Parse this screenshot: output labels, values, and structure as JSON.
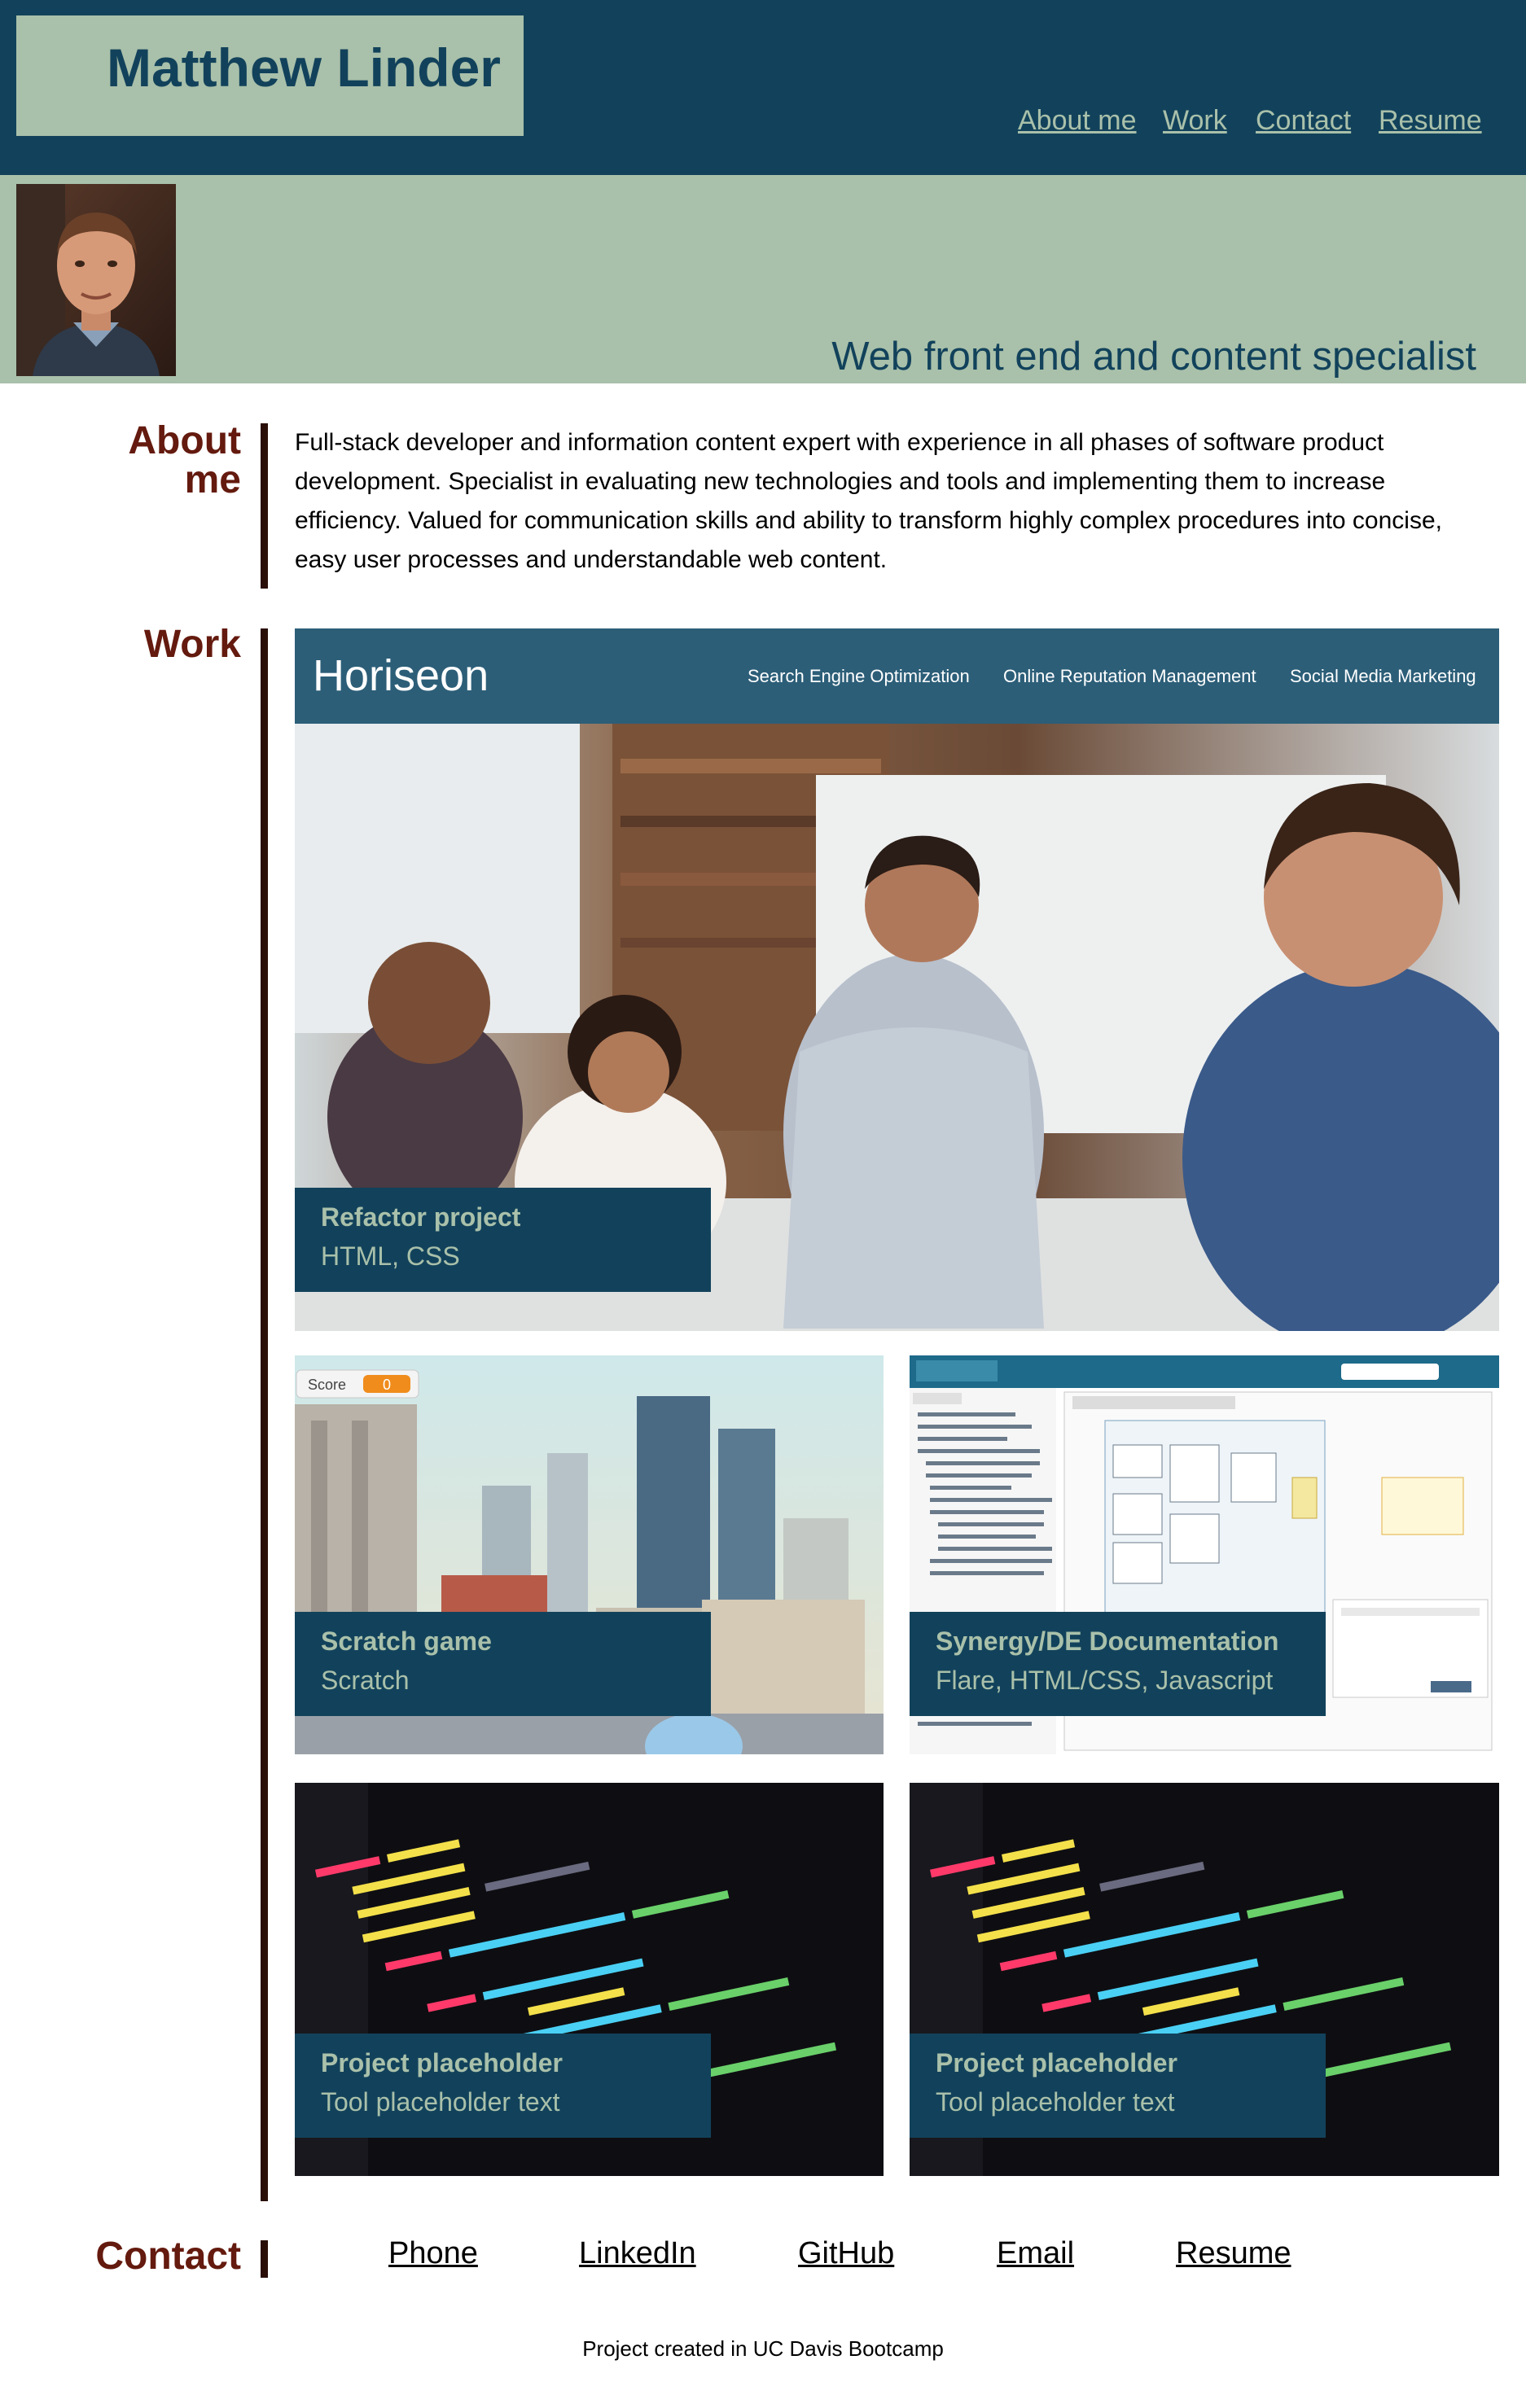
{
  "header": {
    "name": "Matthew Linder",
    "nav": [
      "About me",
      "Work",
      "Contact",
      "Resume"
    ]
  },
  "hero": {
    "tagline": "Web front end and content specialist"
  },
  "about": {
    "heading_line1": "About",
    "heading_line2": "me",
    "text": "Full-stack developer and information content expert with experience in all phases of software product development. Specialist in evaluating new technologies and tools and implementing them to increase efficiency. Valued for communication skills and ability to transform highly complex procedures into concise, easy user processes and understandable web content."
  },
  "work": {
    "heading": "Work",
    "horiseon": {
      "logo": "Horiseon",
      "nav": [
        "Search Engine Optimization",
        "Online Reputation Management",
        "Social Media Marketing"
      ]
    },
    "scratch": {
      "score_label": "Score",
      "score_value": "0"
    },
    "projects": [
      {
        "title": "Refactor project",
        "tools": "HTML, CSS"
      },
      {
        "title": "Scratch game",
        "tools": "Scratch"
      },
      {
        "title": "Synergy/DE Documentation",
        "tools": "Flare, HTML/CSS, Javascript"
      },
      {
        "title": "Project placeholder",
        "tools": "Tool placeholder text"
      },
      {
        "title": "Project placeholder",
        "tools": "Tool placeholder text"
      }
    ]
  },
  "contact": {
    "heading": "Contact",
    "links": [
      "Phone",
      "LinkedIn",
      "GitHub",
      "Email",
      "Resume"
    ]
  },
  "footer": {
    "text": "Project created in UC Davis Bootcamp"
  },
  "colors": {
    "header_bg": "#12425b",
    "sage": "#a9c0aa",
    "heading_red": "#641a0e",
    "rule": "#2a0f08"
  }
}
